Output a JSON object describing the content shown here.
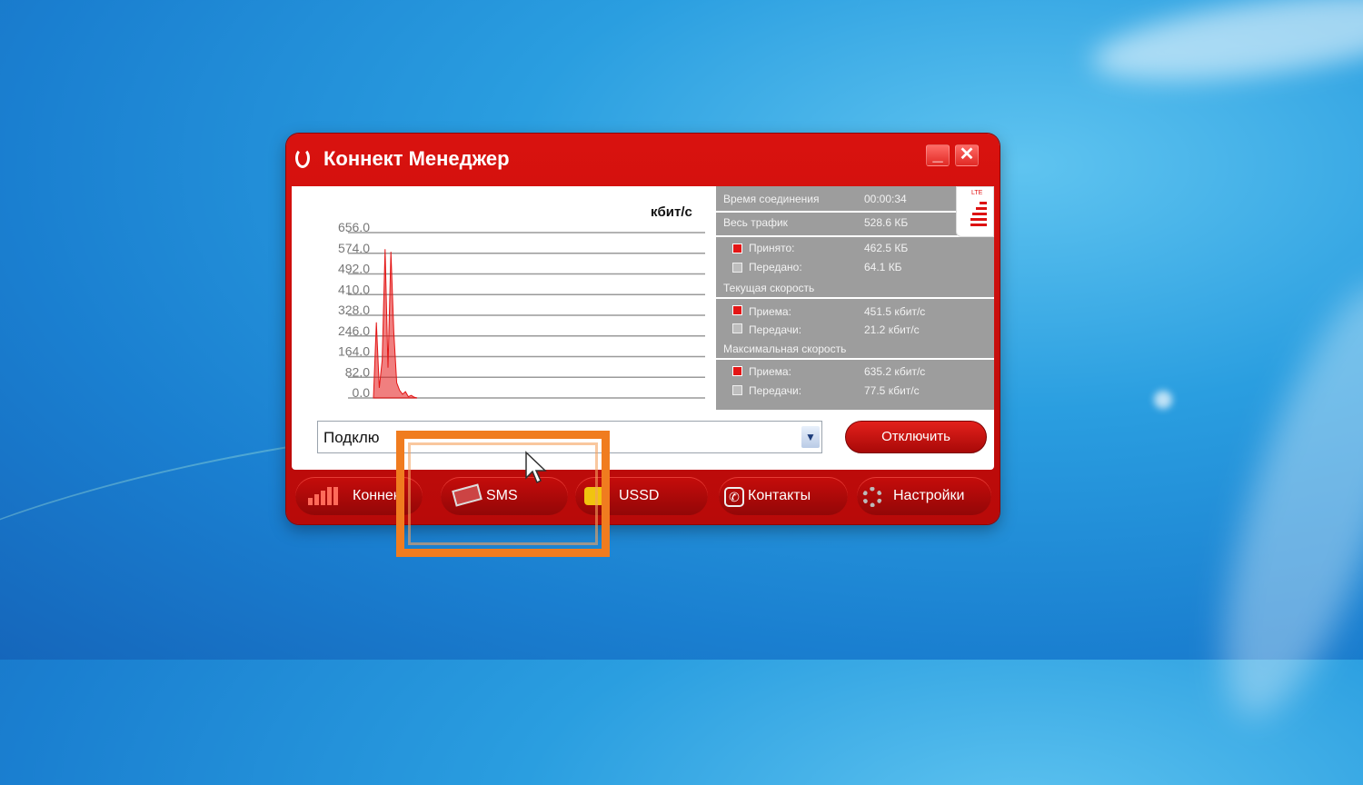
{
  "window": {
    "title": "Коннект Менеджер",
    "minimize_label": "_",
    "close_label": "✕"
  },
  "graph": {
    "unit": "кбит/с",
    "y_ticks": [
      "656.0",
      "574.0",
      "492.0",
      "410.0",
      "328.0",
      "246.0",
      "164.0",
      "82.0",
      "0.0"
    ]
  },
  "stats": {
    "connection_time_label": "Время соединения",
    "connection_time_value": "00:00:34",
    "total_traffic_label": "Весь трафик",
    "total_traffic_value": "528.6 КБ",
    "received_label": "Принято:",
    "received_value": "462.5 КБ",
    "sent_label": "Передано:",
    "sent_value": "64.1 КБ",
    "current_speed_label": "Текущая скорость",
    "current_rx_label": "Приема:",
    "current_rx_value": "451.5 кбит/с",
    "current_tx_label": "Передачи:",
    "current_tx_value": "21.2 кбит/с",
    "max_speed_label": "Максимальная скорость",
    "max_rx_label": "Приема:",
    "max_rx_value": "635.2 кбит/с",
    "max_tx_label": "Передачи:",
    "max_tx_value": "77.5 кбит/с",
    "network_badge": "LTE"
  },
  "connection": {
    "status_text": "Подклю",
    "disconnect_label": "Отключить"
  },
  "nav": {
    "connect": "Коннек",
    "sms": "SMS",
    "ussd": "USSD",
    "contacts": "Контакты",
    "settings": "Настройки"
  },
  "colors": {
    "window_red": "#d9120f",
    "highlight_orange": "#f07c1f",
    "stats_gray": "#9d9d9d",
    "graph_red": "#e31515"
  },
  "chart_data": {
    "type": "area",
    "ylabel": "кбит/с",
    "ylim": [
      0,
      656
    ],
    "ticks": [
      0,
      82,
      164,
      246,
      328,
      410,
      492,
      574,
      656
    ],
    "series": [
      {
        "values": [
          0,
          300,
          40,
          150,
          590,
          120,
          580,
          260,
          60,
          30,
          15,
          25,
          5,
          10,
          3,
          0
        ]
      }
    ]
  }
}
